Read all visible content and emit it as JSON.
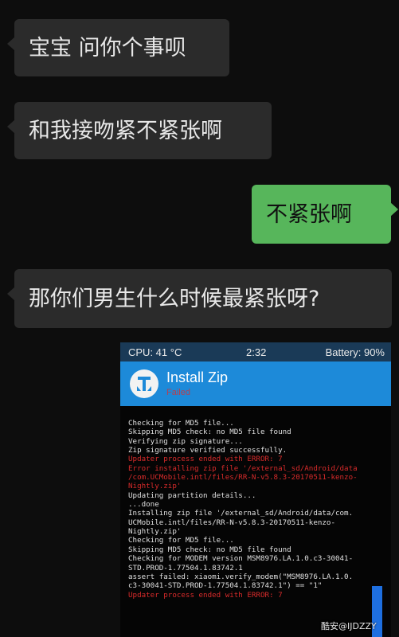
{
  "chat": {
    "messages": [
      {
        "side": "left",
        "text": "宝宝 问你个事呗"
      },
      {
        "side": "left",
        "text": "和我接吻紧不紧张啊"
      },
      {
        "side": "right",
        "text": "不紧张啊"
      },
      {
        "side": "left",
        "text": "那你们男生什么时候最紧张呀?"
      }
    ],
    "incoming_bubble_color": "#2b2b2b",
    "outgoing_bubble_color": "#57b65b"
  },
  "twrp": {
    "status_bar": {
      "cpu": "CPU: 41 °C",
      "time": "2:32",
      "battery": "Battery: 90%"
    },
    "header": {
      "title": "Install Zip",
      "status": "Failed",
      "header_color": "#1d8ad9"
    },
    "log": [
      {
        "type": "normal",
        "text": "Checking for MD5 file..."
      },
      {
        "type": "normal",
        "text": "Skipping MD5 check: no MD5 file found"
      },
      {
        "type": "normal",
        "text": "Verifying zip signature..."
      },
      {
        "type": "normal",
        "text": "Zip signature verified successfully."
      },
      {
        "type": "error",
        "text": "Updater process ended with ERROR: 7"
      },
      {
        "type": "error",
        "text": "Error installing zip file '/external_sd/Android/data"
      },
      {
        "type": "error",
        "text": "/com.UCMobile.intl/files/RR-N-v5.8.3-20170511-kenzo-"
      },
      {
        "type": "error",
        "text": "Nightly.zip'"
      },
      {
        "type": "normal",
        "text": "Updating partition details..."
      },
      {
        "type": "normal",
        "text": "...done"
      },
      {
        "type": "normal",
        "text": "Installing zip file '/external_sd/Android/data/com."
      },
      {
        "type": "normal",
        "text": "UCMobile.intl/files/RR-N-v5.8.3-20170511-kenzo-"
      },
      {
        "type": "normal",
        "text": "Nightly.zip'"
      },
      {
        "type": "normal",
        "text": "Checking for MD5 file..."
      },
      {
        "type": "normal",
        "text": "Skipping MD5 check: no MD5 file found"
      },
      {
        "type": "normal",
        "text": "Checking for MODEM version MSM8976.LA.1.0.c3-30041-"
      },
      {
        "type": "normal",
        "text": "STD.PROD-1.77504.1.83742.1"
      },
      {
        "type": "normal",
        "text": "assert failed: xiaomi.verify_modem(\"MSM8976.LA.1.0."
      },
      {
        "type": "normal",
        "text": "c3-30041-STD.PROD-1.77504.1.83742.1\") == \"1\""
      },
      {
        "type": "error",
        "text": "Updater process ended with ERROR: 7"
      }
    ]
  },
  "watermark": "酷安@IJDZZY"
}
